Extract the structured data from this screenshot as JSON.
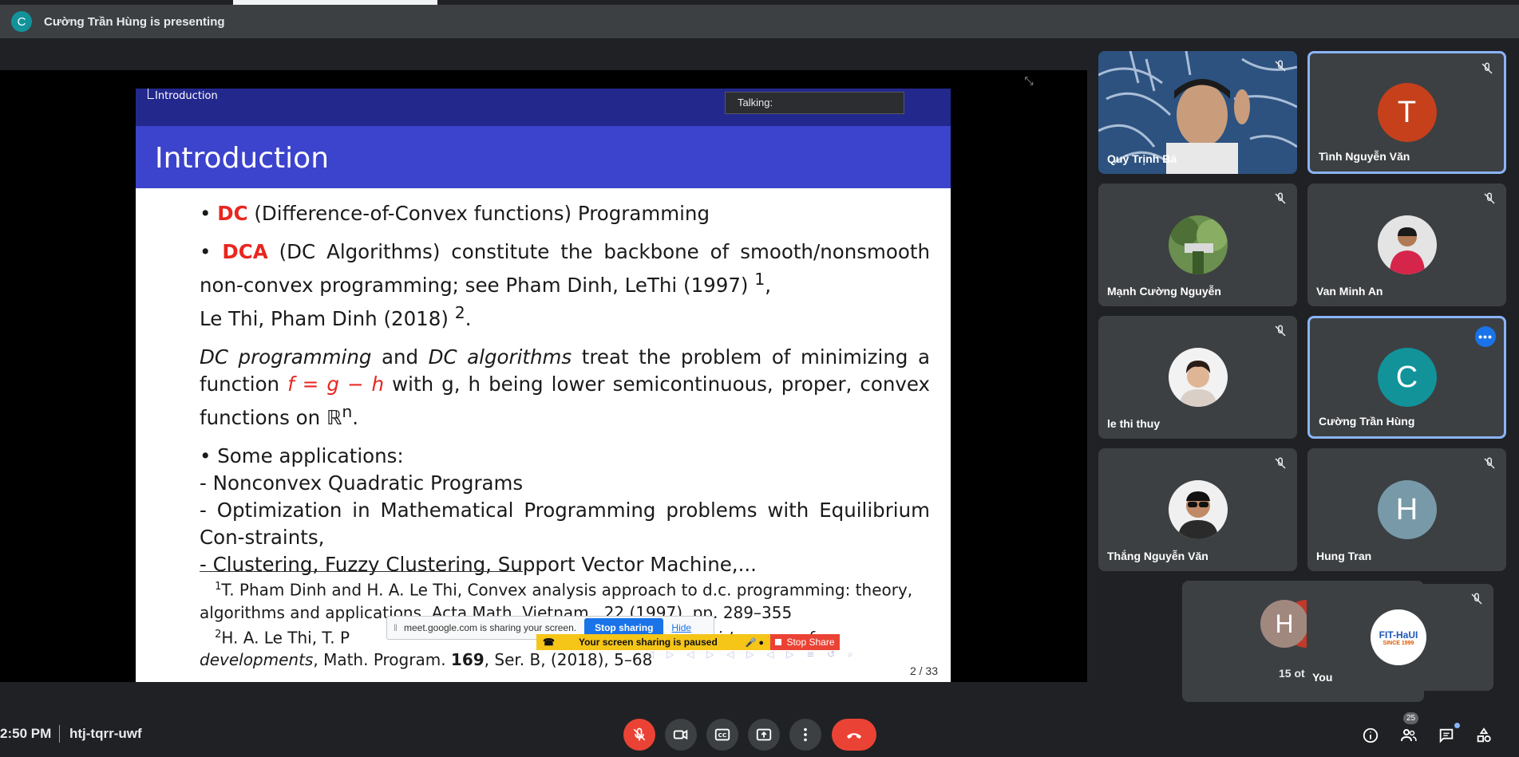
{
  "presenter": {
    "avatar_letter": "C",
    "text": "Cường Trần Hùng is presenting"
  },
  "slide": {
    "section": "Introduction",
    "title": "Introduction",
    "talking": "Talking:",
    "p1_term": "DC",
    "p1_rest": " (Difference-of-Convex functions) Programming",
    "p2_term": "DCA",
    "p2_rest": " (DC Algorithms) constitute the backbone of smooth/nonsmooth non-convex programming; see Pham Dinh, LeThi (1997) ",
    "p2_ref1": "1",
    "p2_tail": ",",
    "p2_line2": "Le Thi, Pham Dinh (2018) ",
    "p2_ref2": "2",
    "p3_i1": "DC programming",
    "p3_and": " and ",
    "p3_i2": "DC algorithms",
    "p3_rest": " treat the problem of minimizing a function ",
    "p3_formula": "f = g − h",
    "p3_rest2": " with g, h being lower semicontinuous, proper, convex functions on ℝ",
    "p3_sup": "n",
    "apps_heading": "Some applications:",
    "apps": [
      "- Nonconvex Quadratic Programs",
      "- Optimization in Mathematical Programming problems with Equilibrium Con-straints,",
      "- Clustering, Fuzzy Clustering, Support Vector Machine,..."
    ],
    "fn1_num": "1",
    "fn1_text": "T. Pham Dinh and H. A. Le Thi, Convex analysis approach to d.c. programming: theory, algorithms and applications, Acta Math. Vietnam., 22 (1997), pp. 289–355",
    "fn2_num": "2",
    "fn2_text": "H. A. Le Thi, T. P",
    "fn2_italic": "thirty years of",
    "fn2_line2_i": "developments",
    "fn2_line2": ", Math. Program. ",
    "fn2_vol": "169",
    "fn2_line2b": ", Ser. B, (2018), 5–68",
    "page": "2 / 33"
  },
  "share_notice": {
    "text": "meet.google.com is sharing your screen.",
    "stop": "Stop sharing",
    "hide": "Hide",
    "paused": "Your screen sharing is paused",
    "stop_share": "Stop Share"
  },
  "participants": [
    {
      "name": "Quý Trịnh Bá",
      "kind": "video"
    },
    {
      "name": "Tình Nguyễn Văn",
      "letter": "T",
      "color": "#c5401b"
    },
    {
      "name": "Mạnh Cường Nguyễn",
      "kind": "photo"
    },
    {
      "name": "Van Minh An",
      "kind": "photo"
    },
    {
      "name": "le thi thuy",
      "kind": "photo"
    },
    {
      "name": "Cường Trần Hùng",
      "letter": "C",
      "color": "#12939a"
    },
    {
      "name": "Thắng Nguyễn Văn",
      "kind": "photo"
    },
    {
      "name": "Hung Tran",
      "letter": "H",
      "color": "#789aa8"
    }
  ],
  "others": {
    "letter": "H",
    "label": "15 ot"
  },
  "self": {
    "name": "You",
    "logo_text": "FIT-HaUI",
    "logo_sub": "SINCE 1999"
  },
  "bottom": {
    "time": "2:50 PM",
    "code": "htj-tqrr-uwf",
    "people_count": "25"
  },
  "colors": {
    "accent": "#8ab4f8",
    "end_call": "#ea4335",
    "tile_bg": "#3c4043",
    "bg": "#202124"
  }
}
